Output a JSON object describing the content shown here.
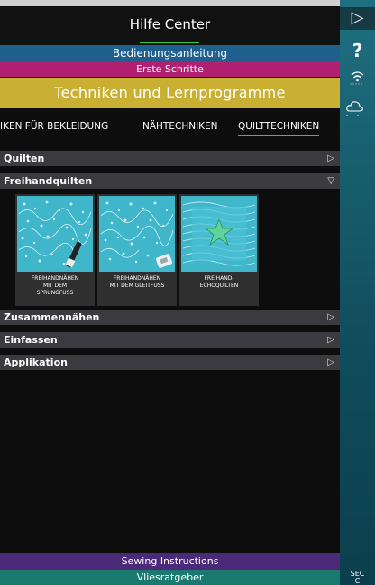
{
  "header": {
    "title": "Hilfe Center"
  },
  "bands": {
    "manual": "Bedienungsanleitung",
    "first_steps": "Erste Schritte",
    "techniques": "Techniken und Lernprogramme"
  },
  "tabs": [
    {
      "label": "IKEN FÜR BEKLEIDUNG"
    },
    {
      "label": "NÄHTECHNIKEN"
    },
    {
      "label": "QUILTTECHNIKEN",
      "active": true
    }
  ],
  "sections": [
    {
      "label": "Quilten",
      "arrow": "▷"
    },
    {
      "label": "Freihandquilten",
      "arrow": "▽"
    },
    {
      "label": "Zusammennähen",
      "arrow": "▷"
    },
    {
      "label": "Einfassen",
      "arrow": "▷"
    },
    {
      "label": "Applikation",
      "arrow": "▷"
    }
  ],
  "cards": [
    {
      "line1": "FREIHANDNÄHEN",
      "line2": "MIT DEM",
      "line3": "SPRUNGFUß"
    },
    {
      "line1": "FREIHANDNÄHEN",
      "line2": "MIT DEM GLEITFUß",
      "line3": ""
    },
    {
      "line1": "FREIHAND-",
      "line2": "ECHOQUILTEN",
      "line3": ""
    }
  ],
  "footer": {
    "sewing_instructions": "Sewing Instructions",
    "vliesratgeber": "Vliesratgeber"
  },
  "rightbar": {
    "play_icon": "▷",
    "help_icon": "?",
    "sec_label": "SEC",
    "sec_sub": "C"
  },
  "colors": {
    "manual_band": "#1f5f8e",
    "first_steps_band": "#b11f70",
    "techniques_band": "#c9b032",
    "active_underline": "#2ecc40",
    "sewing_band": "#4b2a7a",
    "vlies_band": "#1b7a70"
  }
}
